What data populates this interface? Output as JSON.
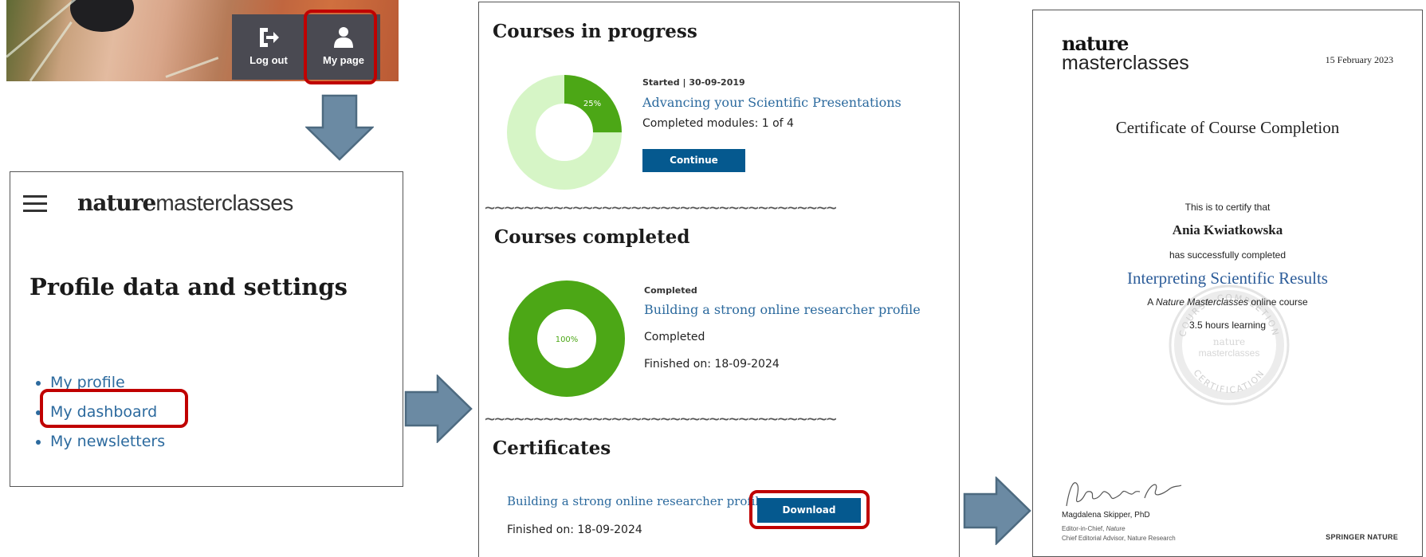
{
  "topbar": {
    "logout_label": "Log out",
    "mypage_label": "My page"
  },
  "profile_panel": {
    "logo_bold": "nature",
    "logo_light": "masterclasses",
    "title": "Profile data and settings",
    "links": [
      "My profile",
      "My dashboard",
      "My newsletters"
    ]
  },
  "in_progress": {
    "title": "Courses in progress",
    "started_label": "Started",
    "started_date": "30-09-2019",
    "course_title": "Advancing your Scientific Presentations",
    "modules": "Completed modules: 1 of 4",
    "percent_label": "25%",
    "percent": 25,
    "button": "Continue"
  },
  "completed": {
    "title": "Courses completed",
    "status_label": "Completed",
    "course_title": "Building a strong online researcher profile",
    "status": "Completed",
    "finished": "Finished on: 18-09-2024",
    "percent_label": "100%",
    "percent": 100
  },
  "certificates": {
    "title": "Certificates",
    "course_title": "Building a strong online researcher profile",
    "finished": "Finished on: 18-09-2024",
    "button": "Download"
  },
  "certificate": {
    "logo_bold": "nature",
    "logo_light": "masterclasses",
    "date": "15 February 2023",
    "heading": "Certificate of Course Completion",
    "certify": "This is to certify that",
    "name": "Ania Kwiatkowska",
    "completed": "has successfully completed",
    "course": "Interpreting Scientific Results",
    "desc_a": "A ",
    "desc_em": "Nature Masterclasses",
    "desc_b": " online course",
    "hours": "3.5 hours learning",
    "seal_top": "COURSE COMPLETION",
    "seal_bottom": "CERTIFICATION",
    "seal_center_1": "nature",
    "seal_center_2": "masterclasses",
    "signature": "Magdalena Skipper",
    "signer": "Magdalena Skipper, PhD",
    "role1_a": "Editor-in-Chief, ",
    "role1_em": "Nature",
    "role2": "Chief Editorial Advisor, Nature Research",
    "publisher": "SPRINGER NATURE"
  },
  "colors": {
    "link": "#2c6a9e",
    "highlight": "#c00000",
    "button": "#05598f",
    "donut_fill": "#4ca716",
    "donut_bg": "#d6f5c6",
    "arrow": "#6b8aa3"
  }
}
